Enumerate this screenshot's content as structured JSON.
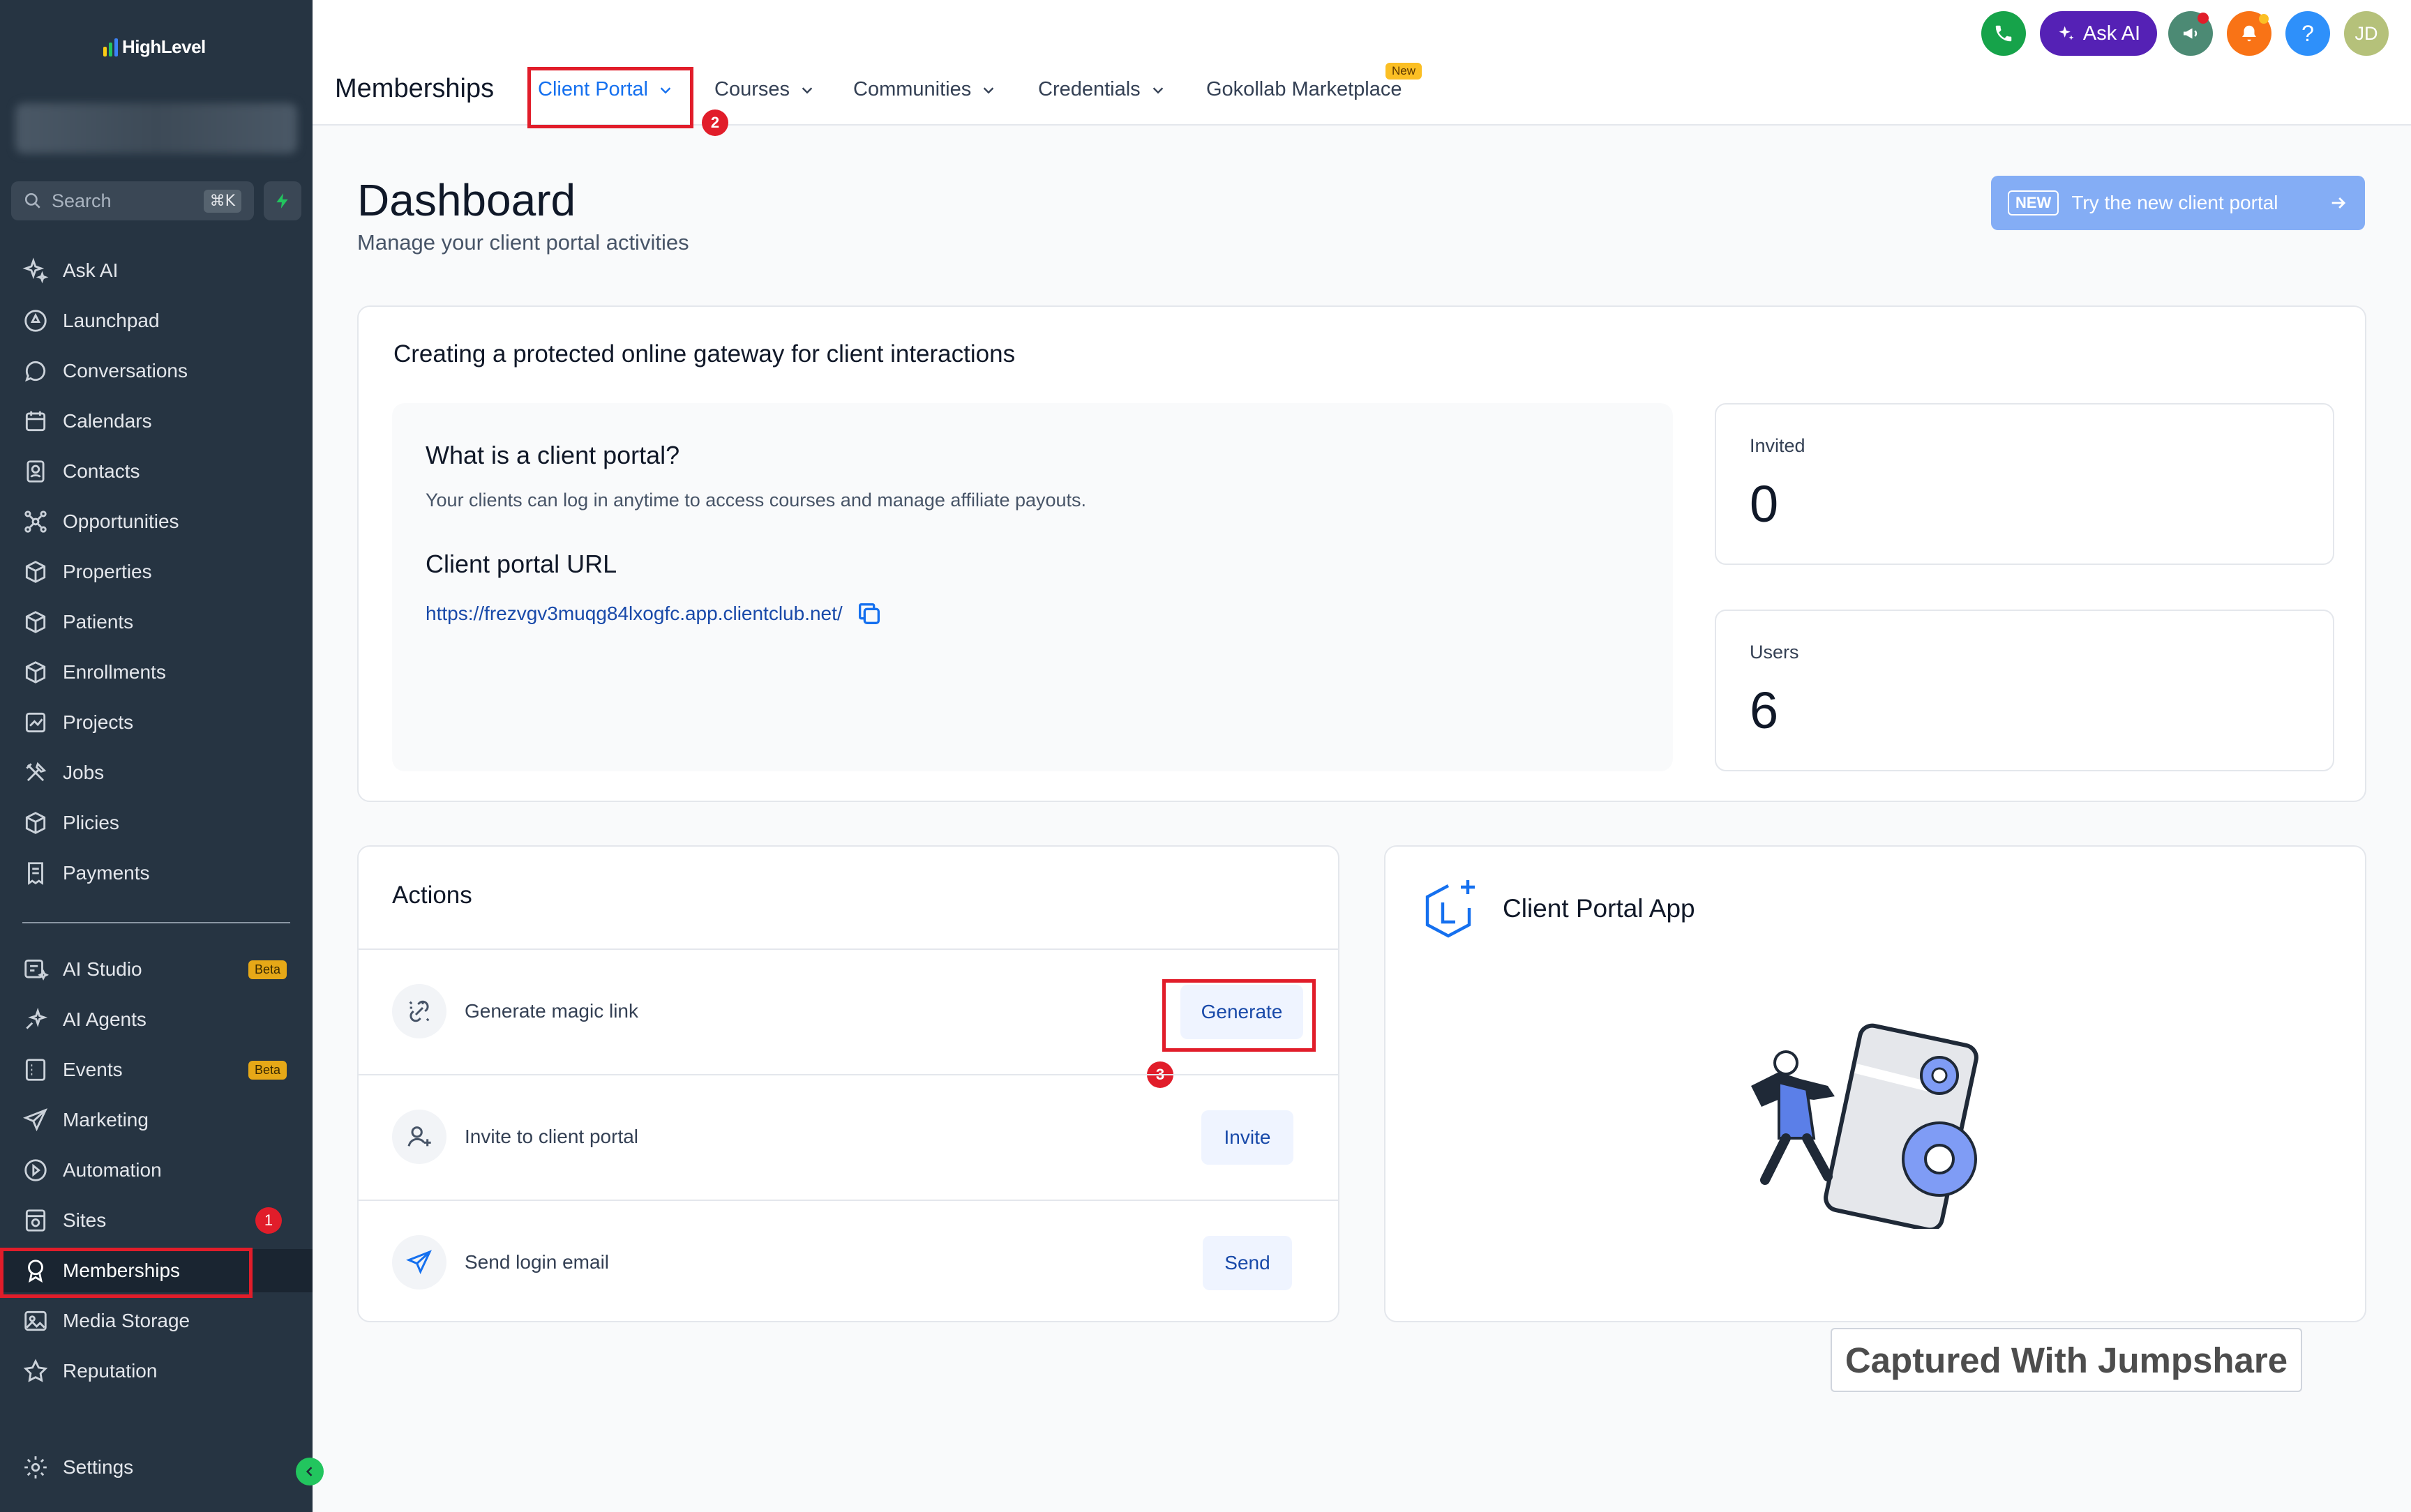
{
  "sidebar": {
    "logo_text": "HighLevel",
    "search": {
      "placeholder": "Search",
      "shortcut": "⌘K"
    },
    "items": [
      {
        "label": "Ask AI",
        "icon": "sparkles-icon"
      },
      {
        "label": "Launchpad",
        "icon": "rocket-icon"
      },
      {
        "label": "Conversations",
        "icon": "chat-bubble-icon"
      },
      {
        "label": "Calendars",
        "icon": "calendar-icon"
      },
      {
        "label": "Contacts",
        "icon": "contacts-icon"
      },
      {
        "label": "Opportunities",
        "icon": "network-icon"
      },
      {
        "label": "Properties",
        "icon": "box-icon"
      },
      {
        "label": "Patients",
        "icon": "box-icon"
      },
      {
        "label": "Enrollments",
        "icon": "box-icon"
      },
      {
        "label": "Projects",
        "icon": "chart-icon"
      },
      {
        "label": "Jobs",
        "icon": "tools-icon"
      },
      {
        "label": "Plicies",
        "icon": "box-icon"
      },
      {
        "label": "Payments",
        "icon": "receipt-icon"
      }
    ],
    "items2": [
      {
        "label": "AI Studio",
        "icon": "ai-studio-icon",
        "badge": "Beta"
      },
      {
        "label": "AI Agents",
        "icon": "ai-agents-icon"
      },
      {
        "label": "Events",
        "icon": "events-icon",
        "badge": "Beta"
      },
      {
        "label": "Marketing",
        "icon": "send-icon"
      },
      {
        "label": "Automation",
        "icon": "automation-icon"
      },
      {
        "label": "Sites",
        "icon": "sites-icon",
        "step": "1"
      },
      {
        "label": "Memberships",
        "icon": "award-icon",
        "active": true
      },
      {
        "label": "Media Storage",
        "icon": "image-icon"
      },
      {
        "label": "Reputation",
        "icon": "star-icon"
      },
      {
        "label": "Settings",
        "icon": "gear-icon"
      }
    ]
  },
  "topbar": {
    "title": "Memberships",
    "tabs": [
      {
        "label": "Client Portal",
        "active": true
      },
      {
        "label": "Courses"
      },
      {
        "label": "Communities"
      },
      {
        "label": "Credentials"
      },
      {
        "label": "Gokollab Marketplace",
        "badge": "New"
      }
    ],
    "step2": "2",
    "ask_ai": "Ask AI",
    "help": "?",
    "avatar": "JD"
  },
  "page": {
    "title": "Dashboard",
    "subtitle": "Manage your client portal activities",
    "try_new": {
      "badge": "NEW",
      "label": "Try the new client portal"
    }
  },
  "gateway": {
    "title": "Creating a protected online gateway for client interactions",
    "what_title": "What is a client portal?",
    "what_desc": "Your clients can log in anytime to access courses and manage affiliate payouts.",
    "url_title": "Client portal URL",
    "url": "https://frezvgv3muqg84lxogfc.app.clientclub.net/",
    "stats": [
      {
        "label": "Invited",
        "value": "0"
      },
      {
        "label": "Users",
        "value": "6"
      }
    ]
  },
  "actions": {
    "title": "Actions",
    "rows": [
      {
        "label": "Generate magic link",
        "button": "Generate",
        "icon": "magic-link-icon"
      },
      {
        "label": "Invite to client portal",
        "button": "Invite",
        "icon": "add-user-icon"
      },
      {
        "label": "Send login email",
        "button": "Send",
        "icon": "send-icon"
      }
    ],
    "step3": "3"
  },
  "app_card": {
    "title": "Client Portal App"
  },
  "watermark": "Captured With Jumpshare",
  "colors": {
    "accent": "#1570ef",
    "sidebar": "#263442",
    "highlight": "#e11d2a"
  }
}
